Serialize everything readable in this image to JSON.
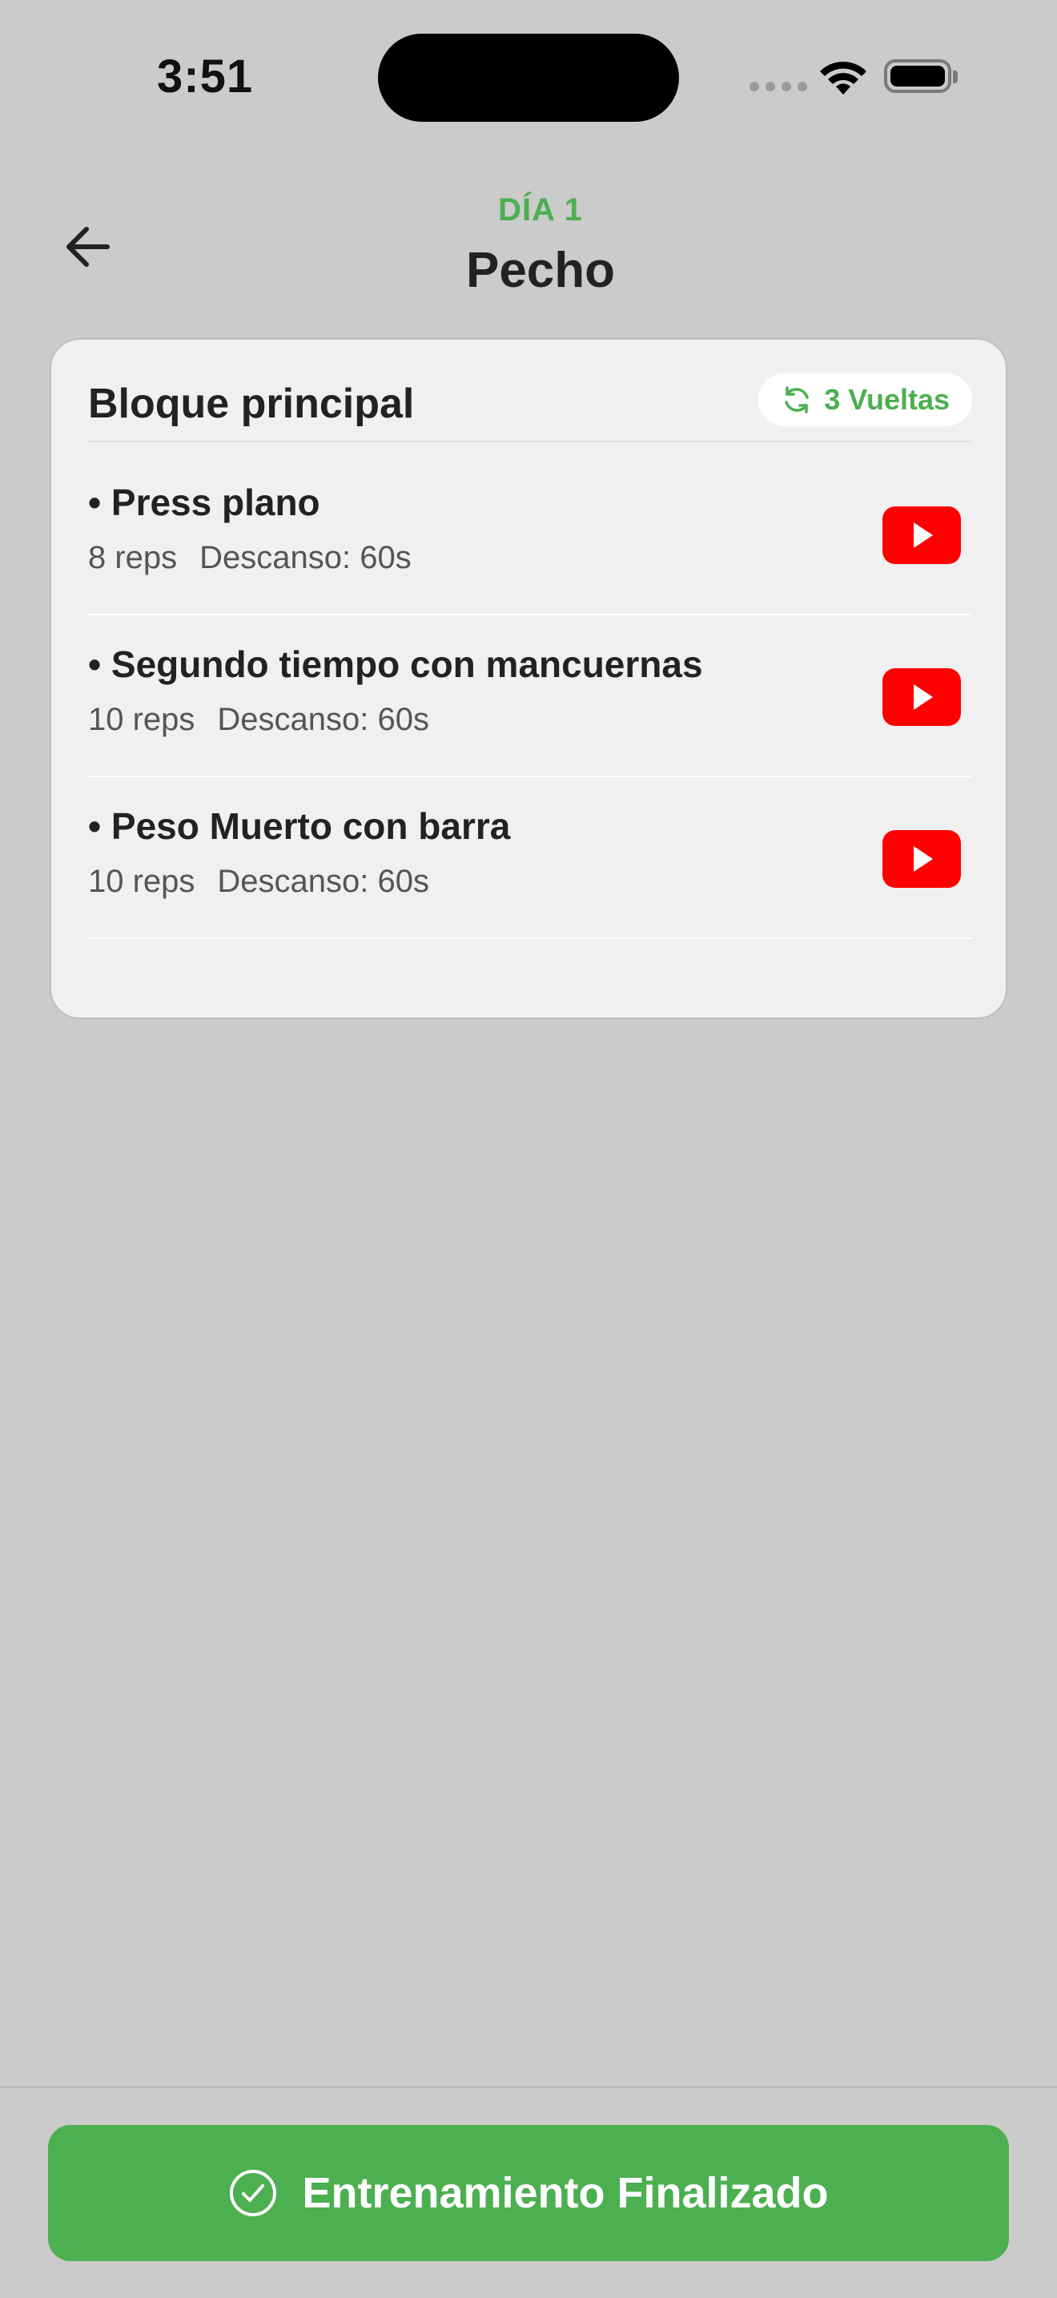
{
  "status_bar": {
    "time": "3:51"
  },
  "header": {
    "day_label": "DÍA 1",
    "title": "Pecho"
  },
  "block": {
    "title": "Bloque principal",
    "rounds_label": "3 Vueltas",
    "exercises": [
      {
        "name": "• Press plano",
        "reps": "8 reps",
        "rest": "Descanso: 60s"
      },
      {
        "name": "• Segundo tiempo con mancuernas",
        "reps": "10 reps",
        "rest": "Descanso: 60s"
      },
      {
        "name": "• Peso Muerto con barra",
        "reps": "10 reps",
        "rest": "Descanso: 60s"
      }
    ]
  },
  "footer": {
    "finish_label": "Entrenamiento Finalizado"
  },
  "colors": {
    "accent": "#4caf50",
    "youtube": "#ff0000",
    "background": "#cbcbcb",
    "card": "#f0f0f0"
  },
  "icons": [
    "back-arrow-icon",
    "refresh-icon",
    "youtube-play-icon",
    "check-circle-icon",
    "wifi-icon",
    "battery-icon"
  ]
}
